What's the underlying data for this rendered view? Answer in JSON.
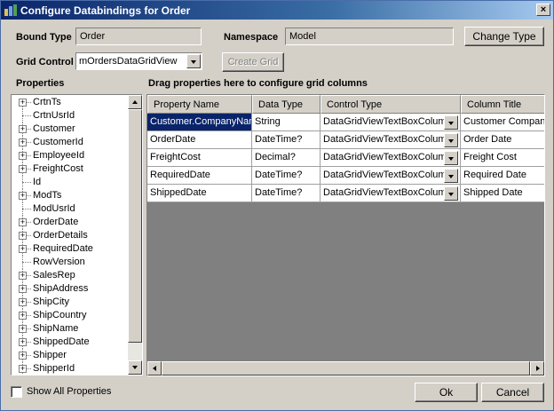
{
  "window": {
    "title": "Configure Databindings for Order",
    "close_glyph": "×"
  },
  "bound_type": {
    "label": "Bound Type",
    "value": "Order"
  },
  "namespace": {
    "label": "Namespace",
    "value": "Model"
  },
  "change_type_button": "Change Type",
  "grid_control": {
    "label": "Grid Control",
    "value": "mOrdersDataGridView"
  },
  "create_grid_button": "Create Grid",
  "properties": {
    "label": "Properties",
    "items": [
      {
        "text": "CrtnTs",
        "expandable": true
      },
      {
        "text": "CrtnUsrId",
        "expandable": false
      },
      {
        "text": "Customer",
        "expandable": true
      },
      {
        "text": "CustomerId",
        "expandable": true
      },
      {
        "text": "EmployeeId",
        "expandable": true
      },
      {
        "text": "FreightCost",
        "expandable": true
      },
      {
        "text": "Id",
        "expandable": false
      },
      {
        "text": "ModTs",
        "expandable": true
      },
      {
        "text": "ModUsrId",
        "expandable": false
      },
      {
        "text": "OrderDate",
        "expandable": true
      },
      {
        "text": "OrderDetails",
        "expandable": true
      },
      {
        "text": "RequiredDate",
        "expandable": true
      },
      {
        "text": "RowVersion",
        "expandable": false
      },
      {
        "text": "SalesRep",
        "expandable": true
      },
      {
        "text": "ShipAddress",
        "expandable": true
      },
      {
        "text": "ShipCity",
        "expandable": true
      },
      {
        "text": "ShipCountry",
        "expandable": true
      },
      {
        "text": "ShipName",
        "expandable": true
      },
      {
        "text": "ShippedDate",
        "expandable": true
      },
      {
        "text": "Shipper",
        "expandable": true
      },
      {
        "text": "ShipperId",
        "expandable": true
      }
    ]
  },
  "grid": {
    "instruction": "Drag properties here to configure grid columns",
    "columns": [
      "Property Name",
      "Data Type",
      "Control Type",
      "Column Title"
    ],
    "rows": [
      {
        "property": "Customer.CompanyName",
        "type": "String",
        "control": "DataGridViewTextBoxColumn",
        "title": "Customer Company Name",
        "selected": true
      },
      {
        "property": "OrderDate",
        "type": "DateTime?",
        "control": "DataGridViewTextBoxColumn",
        "title": "Order Date"
      },
      {
        "property": "FreightCost",
        "type": "Decimal?",
        "control": "DataGridViewTextBoxColumn",
        "title": "Freight Cost"
      },
      {
        "property": "RequiredDate",
        "type": "DateTime?",
        "control": "DataGridViewTextBoxColumn",
        "title": "Required Date"
      },
      {
        "property": "ShippedDate",
        "type": "DateTime?",
        "control": "DataGridViewTextBoxColumn",
        "title": "Shipped Date"
      }
    ]
  },
  "show_all_properties": {
    "label": "Show All Properties",
    "checked": false
  },
  "ok_button": "Ok",
  "cancel_button": "Cancel",
  "colors": {
    "title_bar": "#0a246a",
    "selection": "#0a246a",
    "dialog_bg": "#d4d0c8",
    "grid_bg": "#808080"
  }
}
